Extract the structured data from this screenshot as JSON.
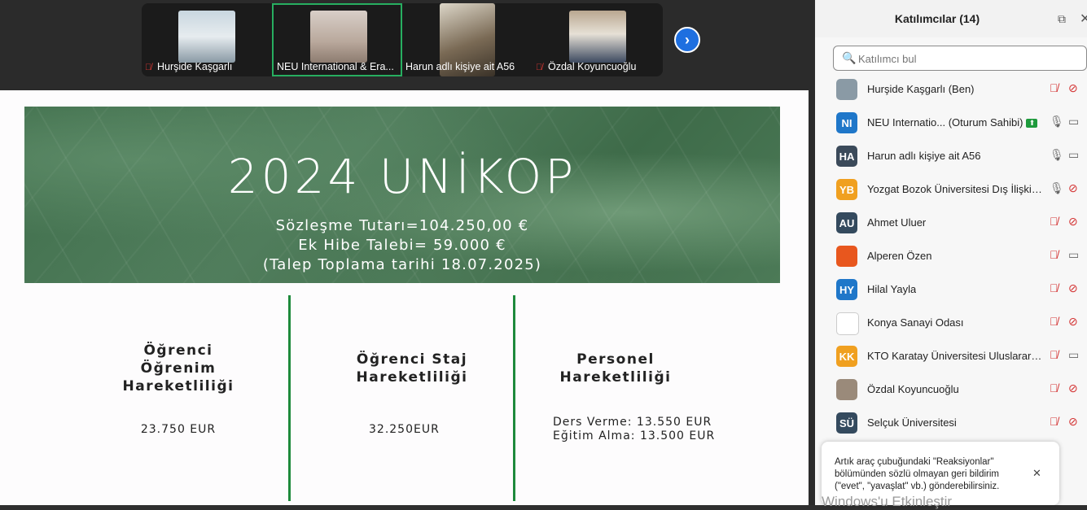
{
  "thumbnails": [
    {
      "name": "Hurşide Kaşgarlı",
      "muted": true
    },
    {
      "name": "NEU International & Era...",
      "muted": false,
      "active": true
    },
    {
      "name": "Harun adlı kişiye ait A56",
      "muted": false
    },
    {
      "name": "Özdal Koyuncuoğlu",
      "muted": true
    }
  ],
  "slide": {
    "title": "2024 UNİKOP",
    "lines": [
      "Sözleşme Tutarı=104.250,00 €",
      "Ek Hibe Talebi= 59.000 €",
      "(Talep Toplama tarihi 18.07.2025)"
    ],
    "columns": [
      {
        "title": "Öğrenci\nÖğrenim\nHareketliliği",
        "value": "23.750 EUR"
      },
      {
        "title": "Öğrenci Staj\nHareketliliği",
        "value": "32.250EUR"
      },
      {
        "title": "Personel\nHareketliliği",
        "value": "Ders Verme: 13.550 EUR\nEğitim Alma: 13.500 EUR"
      }
    ],
    "colors": {
      "banner": "#3f6e4b",
      "divider": "#1e8a3c"
    }
  },
  "panel": {
    "title": "Katılımcılar (14)",
    "search_placeholder": "Katılımcı bul",
    "participants": [
      {
        "initials": "",
        "name": "Hurşide Kaşgarlı (Ben)",
        "color": "#8a9aa5",
        "mic": "muted",
        "cam": "off"
      },
      {
        "initials": "NI",
        "name": "NEU Internatio...   (Oturum Sahibi)",
        "color": "#1f77c9",
        "host": true,
        "mic": "on",
        "cam": "on"
      },
      {
        "initials": "HA",
        "name": "Harun adlı kişiye ait A56",
        "color": "#3b4a5a",
        "mic": "on",
        "cam": "on"
      },
      {
        "initials": "YB",
        "name": "Yozgat Bozok Üniversitesi Dış İlişkile...",
        "color": "#f0a020",
        "mic": "on",
        "cam": "off"
      },
      {
        "initials": "AU",
        "name": "Ahmet Uluer",
        "color": "#344a5e",
        "mic": "muted",
        "cam": "off"
      },
      {
        "initials": "",
        "name": "Alperen Özen",
        "color": "#e8571e",
        "mic": "muted",
        "cam": "on"
      },
      {
        "initials": "HY",
        "name": "Hilal Yayla",
        "color": "#1f77c9",
        "mic": "muted",
        "cam": "off"
      },
      {
        "initials": "",
        "name": "Konya Sanayi Odası",
        "color": "#ffffff",
        "mic": "muted",
        "cam": "off"
      },
      {
        "initials": "KK",
        "name": "KTO Karatay Üniversitesi Uluslarara...",
        "color": "#f0a020",
        "mic": "muted",
        "cam": "on"
      },
      {
        "initials": "",
        "name": "Özdal Koyuncuoğlu",
        "color": "#9a8a7a",
        "mic": "muted",
        "cam": "off"
      },
      {
        "initials": "SÜ",
        "name": "Selçuk Üniversitesi",
        "color": "#344a5e",
        "mic": "muted",
        "cam": "off"
      }
    ],
    "toast": "Artık araç çubuğundaki \"Reaksiyonlar\" bölümünden sözlü olmayan geri bildirim (\"evet\", \"yavaşlat\" vb.) gönderebilirsiniz.",
    "watermark": "Windows'u Etkinleştir"
  }
}
